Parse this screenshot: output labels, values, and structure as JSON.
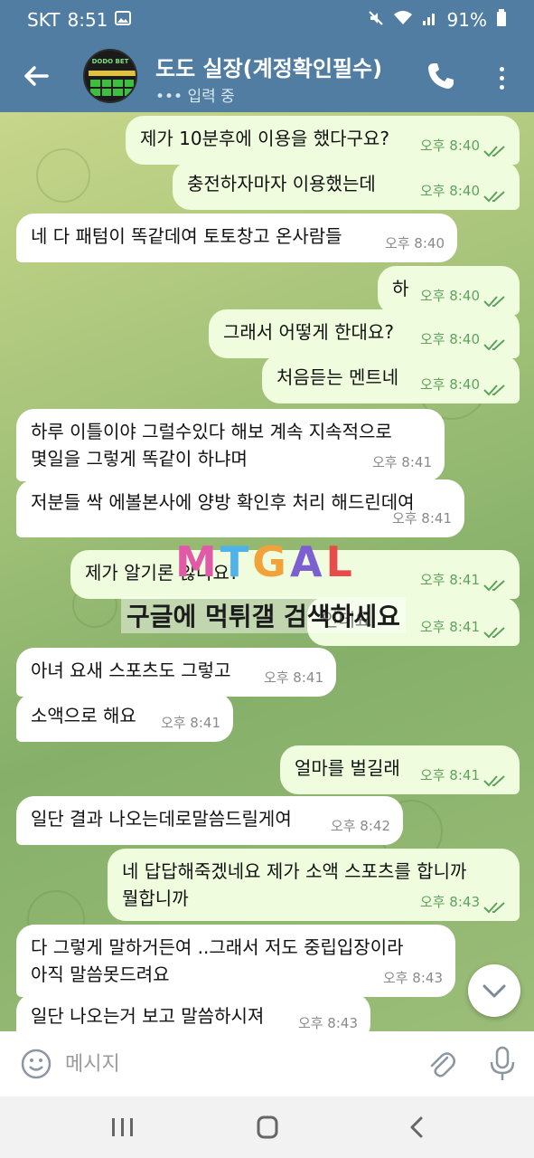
{
  "status_bar": {
    "carrier": "SKT",
    "time": "8:51",
    "battery": "91%"
  },
  "header": {
    "title": "도도 실장(계정확인필수)",
    "status": "••• 입력 중",
    "avatar_text": "DODO BET"
  },
  "messages": [
    {
      "side": "out",
      "lines": [
        "제가 10분후에 이용을 했다구요?"
      ],
      "time": "오후 8:40"
    },
    {
      "side": "out",
      "lines": [
        "충전하자마자 이용했는데"
      ],
      "time": "오후 8:40"
    },
    {
      "side": "in",
      "lines": [
        "네 다 패텀이 똑같데여 토토창고 온사람들"
      ],
      "time": "오후 8:40"
    },
    {
      "side": "out",
      "lines": [
        "하"
      ],
      "time": "오후 8:40"
    },
    {
      "side": "out",
      "lines": [
        "그래서 어떻게 한대요?"
      ],
      "time": "오후 8:40"
    },
    {
      "side": "out",
      "lines": [
        "처음듣는 멘트네"
      ],
      "time": "오후 8:40"
    },
    {
      "side": "in",
      "lines": [
        "하루 이틀이야 그럴수있다 해보 계속 지속적으로",
        "몇일을 그렇게 똑같이 하냐며"
      ],
      "time": "오후 8:41"
    },
    {
      "side": "in",
      "lines": [
        "저분들 싹 에볼본사에 양방 확인후 처리 해드린데여"
      ],
      "time": "오후 8:41"
    },
    {
      "side": "out",
      "lines": [
        "제가 알기론                      않나요?"
      ],
      "time": "오후 8:41"
    },
    {
      "side": "out",
      "lines": [
        "인데요"
      ],
      "time": "오후 8:41"
    },
    {
      "side": "in",
      "lines": [
        "아녀 요새 스포츠도 그렇고"
      ],
      "time": "오후 8:41"
    },
    {
      "side": "in",
      "lines": [
        "소액으로 해요"
      ],
      "time": "오후 8:41"
    },
    {
      "side": "out",
      "lines": [
        "얼마를 벌길래"
      ],
      "time": "오후 8:41"
    },
    {
      "side": "in",
      "lines": [
        "일단 결과 나오는데로말씀드릴게여"
      ],
      "time": "오후 8:42"
    },
    {
      "side": "out",
      "lines": [
        "네 답답해죽겠네요 제가 소액 스포츠를 합니까",
        "뭘합니까"
      ],
      "time": "오후 8:43"
    },
    {
      "side": "in",
      "lines": [
        "다 그렇게 말하거든여 ..그래서 저도 중립입장이라",
        "아직 말씀못드려요"
      ],
      "time": "오후 8:43"
    },
    {
      "side": "in",
      "lines": [
        "일단 나오는거 보고 말씀하시져"
      ],
      "time": "오후 8:43"
    }
  ],
  "watermark": {
    "logo": "MTGAL",
    "text": "구글에 먹튀갤 검색하세요"
  },
  "input": {
    "placeholder": "메시지"
  },
  "colors": {
    "header_bg": "#517da2",
    "bubble_out": "#effdde",
    "bubble_in": "#ffffff",
    "check_color": "#5fa25f"
  },
  "icons": [
    "back-arrow-icon",
    "phone-icon",
    "more-vert-icon",
    "emoji-icon",
    "attach-icon",
    "mic-icon",
    "chevron-down-icon",
    "double-check-icon"
  ]
}
